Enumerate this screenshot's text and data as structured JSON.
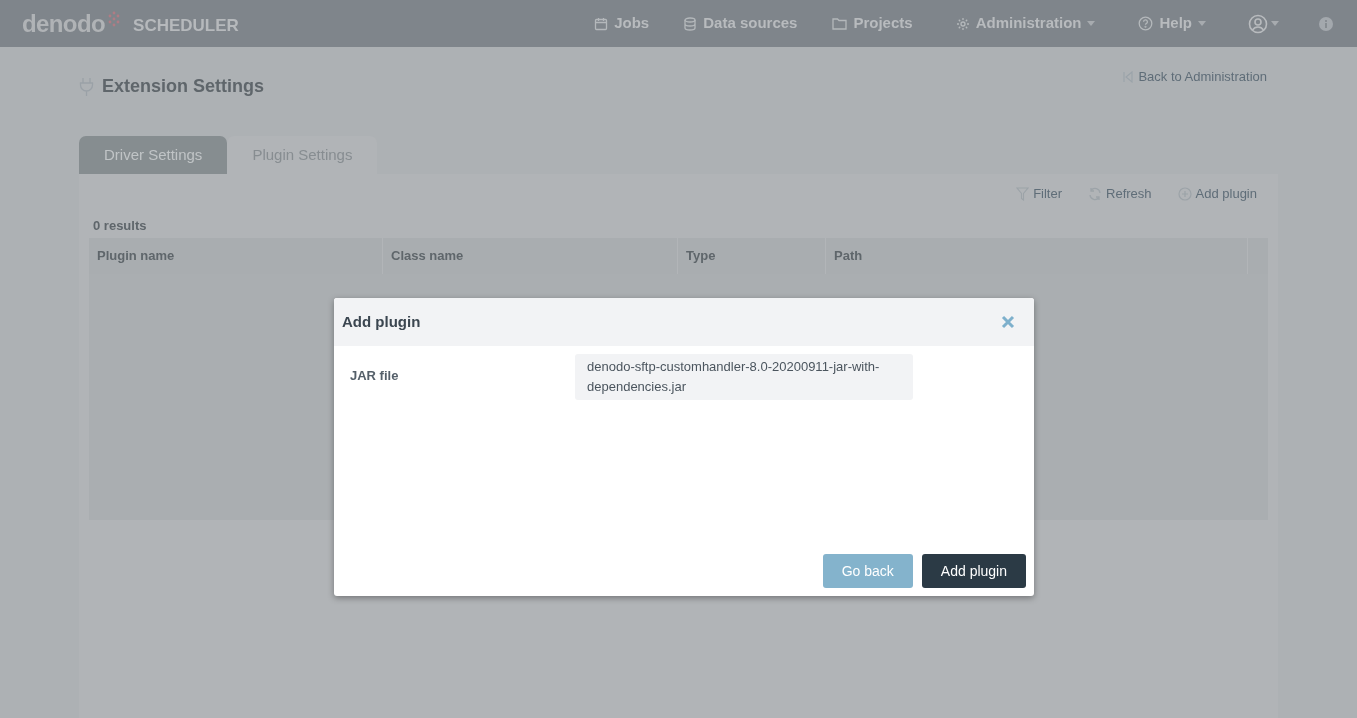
{
  "header": {
    "logo": "denodo",
    "product": "SCHEDULER",
    "nav": [
      {
        "label": "Jobs",
        "dropdown": false
      },
      {
        "label": "Data sources",
        "dropdown": false
      },
      {
        "label": "Projects",
        "dropdown": false
      },
      {
        "label": "Administration",
        "dropdown": true
      },
      {
        "label": "Help",
        "dropdown": true
      }
    ]
  },
  "page": {
    "title": "Extension Settings",
    "back_link": "Back to Administration",
    "tabs": [
      {
        "label": "Driver Settings",
        "selected": false
      },
      {
        "label": "Plugin Settings",
        "selected": true
      }
    ],
    "toolbar": [
      {
        "label": "Filter"
      },
      {
        "label": "Refresh"
      },
      {
        "label": "Add plugin"
      }
    ],
    "result_count": "0 results",
    "table": {
      "columns": [
        "Plugin name",
        "Class name",
        "Type",
        "Path"
      ]
    }
  },
  "dialog": {
    "title": "Add plugin",
    "fields": [
      {
        "label": "JAR file",
        "value": "denodo-sftp-customhandler-8.0-20200911-jar-with-dependencies.jar"
      }
    ],
    "buttons": [
      {
        "label": "Go back",
        "kind": "secondary"
      },
      {
        "label": "Add plugin",
        "kind": "primary"
      }
    ]
  }
}
